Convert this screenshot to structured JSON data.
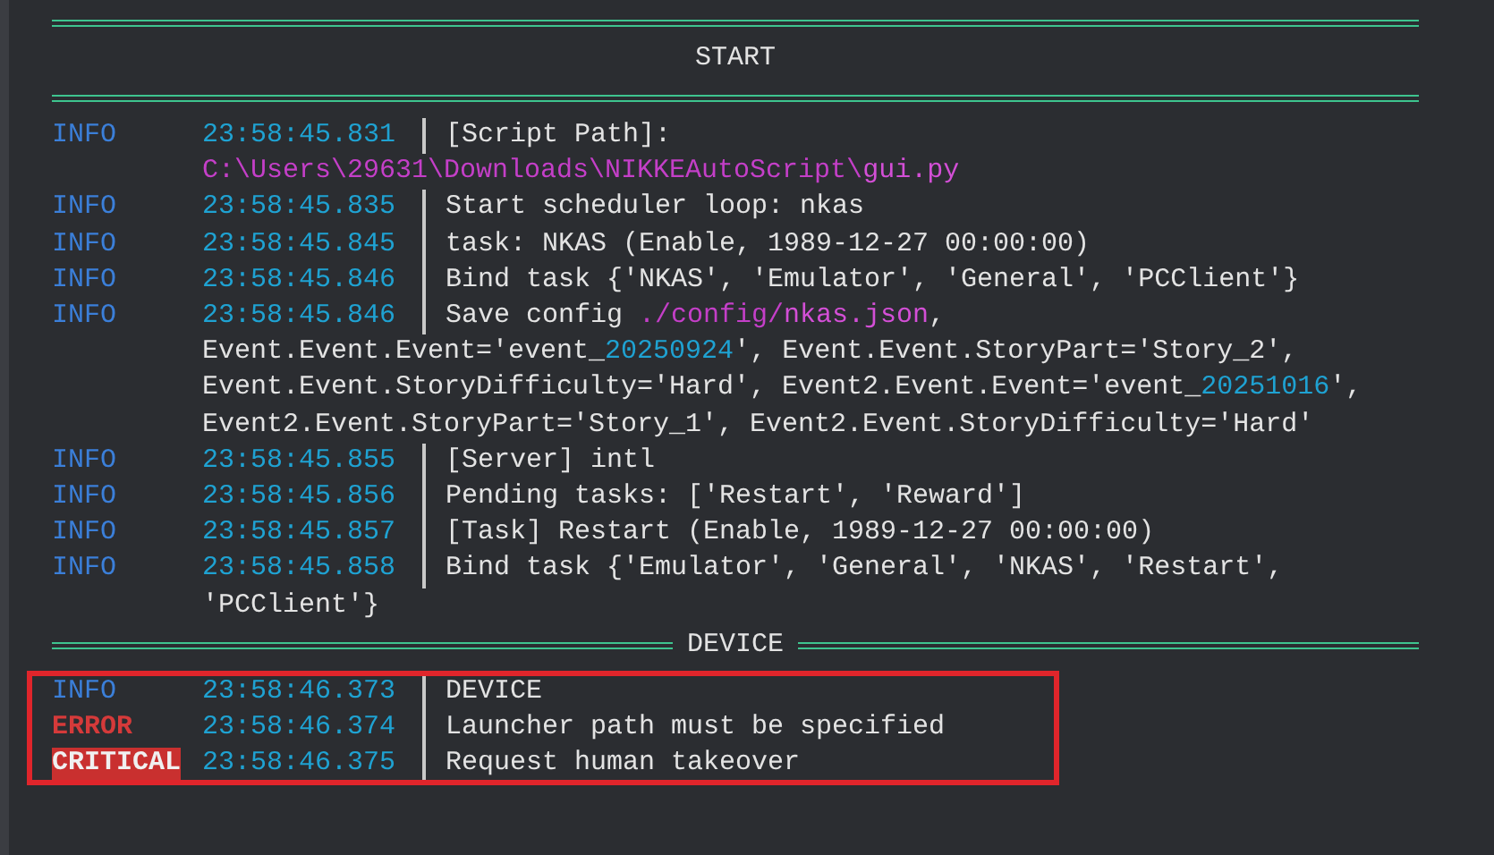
{
  "sections": [
    {
      "title": "START",
      "kind": "banner",
      "rows": [
        {
          "level": "INFO",
          "kind": "info",
          "time": "23:58:45.831",
          "lines": [
            [
              {
                "text": "[Script Path]:",
                "kind": "text"
              }
            ],
            [
              {
                "text": "C:\\Users\\29631\\Downloads\\NIKKEAutoScript\\",
                "kind": "path"
              },
              {
                "text": "gui.py",
                "kind": "file"
              }
            ]
          ]
        },
        {
          "level": "INFO",
          "kind": "info",
          "time": "23:58:45.835",
          "lines": [
            [
              {
                "text": "Start scheduler loop: nkas",
                "kind": "text"
              }
            ]
          ]
        },
        {
          "level": "INFO",
          "kind": "info",
          "time": "23:58:45.845",
          "lines": [
            [
              {
                "text": "task: NKAS (Enable, 1989-12-27 00:00:00)",
                "kind": "text"
              }
            ]
          ]
        },
        {
          "level": "INFO",
          "kind": "info",
          "time": "23:58:45.846",
          "lines": [
            [
              {
                "text": "Bind task {'NKAS', 'Emulator', 'General', 'PCClient'}",
                "kind": "text"
              }
            ]
          ]
        },
        {
          "level": "INFO",
          "kind": "info",
          "time": "23:58:45.846",
          "lines": [
            [
              {
                "text": "Save config ",
                "kind": "text"
              },
              {
                "text": "./config/",
                "kind": "path"
              },
              {
                "text": "nkas.json",
                "kind": "file"
              },
              {
                "text": ",",
                "kind": "text"
              }
            ],
            [
              {
                "text": "Event.Event.Event='event_",
                "kind": "text"
              },
              {
                "text": "20250924",
                "kind": "number"
              },
              {
                "text": "', Event.Event.StoryPart='Story_2',",
                "kind": "text"
              }
            ],
            [
              {
                "text": "Event.Event.StoryDifficulty='Hard', Event2.Event.Event='event_",
                "kind": "text"
              },
              {
                "text": "20251016",
                "kind": "number"
              },
              {
                "text": "',",
                "kind": "text"
              }
            ],
            [
              {
                "text": "Event2.Event.StoryPart='Story_1', Event2.Event.StoryDifficulty='Hard'",
                "kind": "text"
              }
            ]
          ]
        },
        {
          "level": "INFO",
          "kind": "info",
          "time": "23:58:45.855",
          "lines": [
            [
              {
                "text": "[Server] intl",
                "kind": "text"
              }
            ]
          ]
        },
        {
          "level": "INFO",
          "kind": "info",
          "time": "23:58:45.856",
          "lines": [
            [
              {
                "text": "Pending tasks: ['Restart', 'Reward']",
                "kind": "text"
              }
            ]
          ]
        },
        {
          "level": "INFO",
          "kind": "info",
          "time": "23:58:45.857",
          "lines": [
            [
              {
                "text": "[Task] Restart (Enable, 1989-12-27 00:00:00)",
                "kind": "text"
              }
            ]
          ]
        },
        {
          "level": "INFO",
          "kind": "info",
          "time": "23:58:45.858",
          "lines": [
            [
              {
                "text": "Bind task {'Emulator', 'General', 'NKAS', 'Restart',",
                "kind": "text"
              }
            ],
            [
              {
                "text": "'PCClient'}",
                "kind": "text"
              }
            ]
          ]
        }
      ]
    },
    {
      "title": "DEVICE",
      "kind": "inline",
      "highlighted": true,
      "rows": [
        {
          "level": "INFO",
          "kind": "info",
          "time": "23:58:46.373",
          "lines": [
            [
              {
                "text": "DEVICE",
                "kind": "text"
              }
            ]
          ]
        },
        {
          "level": "ERROR",
          "kind": "error",
          "time": "23:58:46.374",
          "lines": [
            [
              {
                "text": "Launcher path must be specified",
                "kind": "text"
              }
            ]
          ]
        },
        {
          "level": "CRITICAL",
          "kind": "critical",
          "time": "23:58:46.375",
          "lines": [
            [
              {
                "text": "Request human takeover",
                "kind": "text"
              }
            ]
          ]
        }
      ]
    }
  ]
}
